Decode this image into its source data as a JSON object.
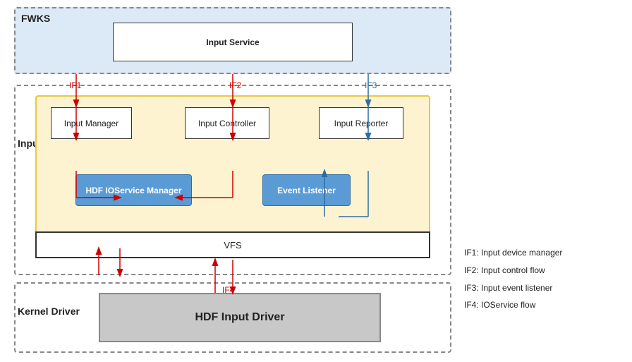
{
  "fwks": {
    "label": "FWKS",
    "input_service": "Input Service"
  },
  "hdi": {
    "label": "Input-HDI",
    "inner_components": {
      "input_manager": "Input Manager",
      "input_controller": "Input Controller",
      "input_reporter": "Input Reporter",
      "hdf_ioservice": "HDF IOService Manager",
      "event_listener": "Event Listener"
    },
    "vfs": "VFS"
  },
  "kernel": {
    "label": "Kernel Driver",
    "hdf_driver": "HDF Input Driver"
  },
  "interfaces": {
    "if1": "IF1",
    "if2": "IF2",
    "if3": "IF3",
    "if4": "IF4"
  },
  "legend": {
    "if1": "IF1: Input device manager",
    "if2": "IF2: Input control flow",
    "if3": "IF3: Input event listener",
    "if4": "IF4:  IOService flow"
  }
}
